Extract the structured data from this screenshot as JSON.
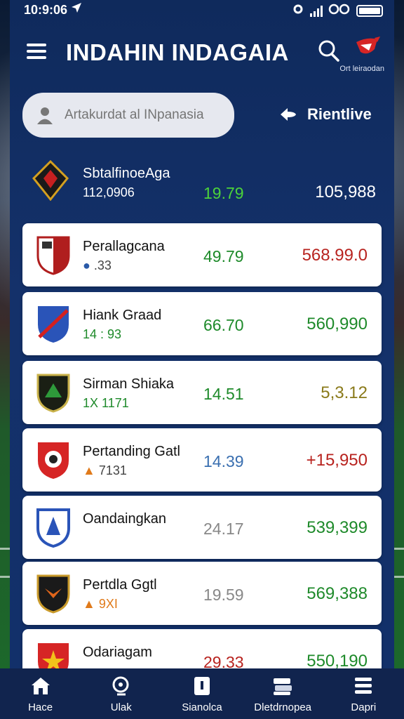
{
  "status_bar": {
    "time": "10:9:06"
  },
  "header": {
    "title": "INDAHIN INDAGAIA",
    "logo_caption": "Ort leiraodan"
  },
  "search": {
    "placeholder": "Artakurdat al INpanasia"
  },
  "refresh_label": "Rientlive",
  "featured": {
    "name": "SbtalfinoeAga",
    "sub": "112,0906",
    "value1": "19.79",
    "value2": "105,988",
    "value1_color": "#4cd33a"
  },
  "rows": [
    {
      "name": "Perallagcana",
      "sub": ".33",
      "value1": "49.79",
      "value2": "568.99.0",
      "v1_color": "#1e8a2a",
      "v2_color": "#b8231f"
    },
    {
      "name": "Hiank Graad",
      "sub": "14 : 93",
      "value1": "66.70",
      "value2": "560,990",
      "v1_color": "#1e8a2a",
      "v2_color": "#1e8a2a"
    },
    {
      "name": "Sirman Shiaka",
      "sub": "1X 1171",
      "value1": "14.51",
      "value2": "5,3.12",
      "v1_color": "#1e8a2a",
      "v2_color": "#8a7a1a"
    },
    {
      "name": "Pertanding Gatl",
      "sub": "7131",
      "value1": "14.39",
      "value2": "+15,950",
      "v1_color": "#3a6fb0",
      "v2_color": "#b8231f"
    },
    {
      "name": "Oandaingkan",
      "sub": "",
      "value1": "24.17",
      "value2": "539,399",
      "v1_color": "#888888",
      "v2_color": "#1e8a2a"
    },
    {
      "name": "Pertdla Ggtl",
      "sub": "9XI",
      "value1": "19.59",
      "value2": "569,388",
      "v1_color": "#888888",
      "v2_color": "#1e8a2a"
    },
    {
      "name": "Odariagam",
      "sub": "",
      "value1": "29.33",
      "value2": "550,190",
      "v1_color": "#b8231f",
      "v2_color": "#1e8a2a"
    }
  ],
  "nav": [
    {
      "label": "Hace",
      "icon": "home-icon"
    },
    {
      "label": "Ulak",
      "icon": "search-icon"
    },
    {
      "label": "Sianolca",
      "icon": "info-icon"
    },
    {
      "label": "Dletdrnopea",
      "icon": "stack-icon"
    },
    {
      "label": "Dapri",
      "icon": "menu-icon"
    }
  ]
}
